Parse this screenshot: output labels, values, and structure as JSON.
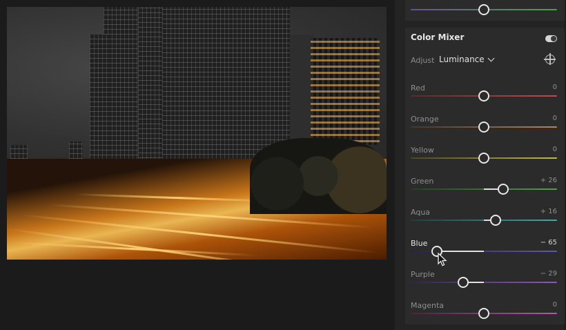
{
  "panel": {
    "title": "Color Mixer",
    "adjust_label": "Adjust",
    "adjust_value": "Luminance",
    "sliders": [
      {
        "id": "red",
        "label": "Red",
        "value_text": "0",
        "fraction": 0.5,
        "track": "linear-gradient(90deg,#5a2a2a,#c44a4a)"
      },
      {
        "id": "orange",
        "label": "Orange",
        "value_text": "0",
        "fraction": 0.5,
        "track": "linear-gradient(90deg,#4a3420,#c98040)"
      },
      {
        "id": "yellow",
        "label": "Yellow",
        "value_text": "0",
        "fraction": 0.5,
        "track": "linear-gradient(90deg,#4a4620,#c6b846)"
      },
      {
        "id": "green",
        "label": "Green",
        "value_text": "+ 26",
        "fraction": 0.63,
        "track": "linear-gradient(90deg,#23401f,#52a24a)"
      },
      {
        "id": "aqua",
        "label": "Aqua",
        "value_text": "+ 16",
        "fraction": 0.58,
        "track": "linear-gradient(90deg,#1f3d40,#4aa4a6)"
      },
      {
        "id": "blue",
        "label": "Blue",
        "value_text": "− 65",
        "fraction": 0.18,
        "track": "linear-gradient(90deg,#23234a,#5a5ab4)",
        "active": true
      },
      {
        "id": "purple",
        "label": "Purple",
        "value_text": "− 29",
        "fraction": 0.36,
        "track": "linear-gradient(90deg,#32234a,#8b5ab4)"
      },
      {
        "id": "magenta",
        "label": "Magenta",
        "value_text": "0",
        "fraction": 0.5,
        "track": "linear-gradient(90deg,#4a2340,#b45aa4)"
      }
    ]
  },
  "top_slider": {
    "fraction": 0.5,
    "track": "linear-gradient(90deg,#6a5090,#50a050)"
  },
  "colors": {
    "panel_bg": "#232323",
    "card_bg": "#2b2b2b",
    "thumb": "#e8e8e8"
  },
  "icons": {
    "toggle": "toggle-switch-icon",
    "chevron": "chevron-down-icon",
    "target": "targeted-adjustment-icon",
    "cursor": "mouse-pointer-icon"
  }
}
